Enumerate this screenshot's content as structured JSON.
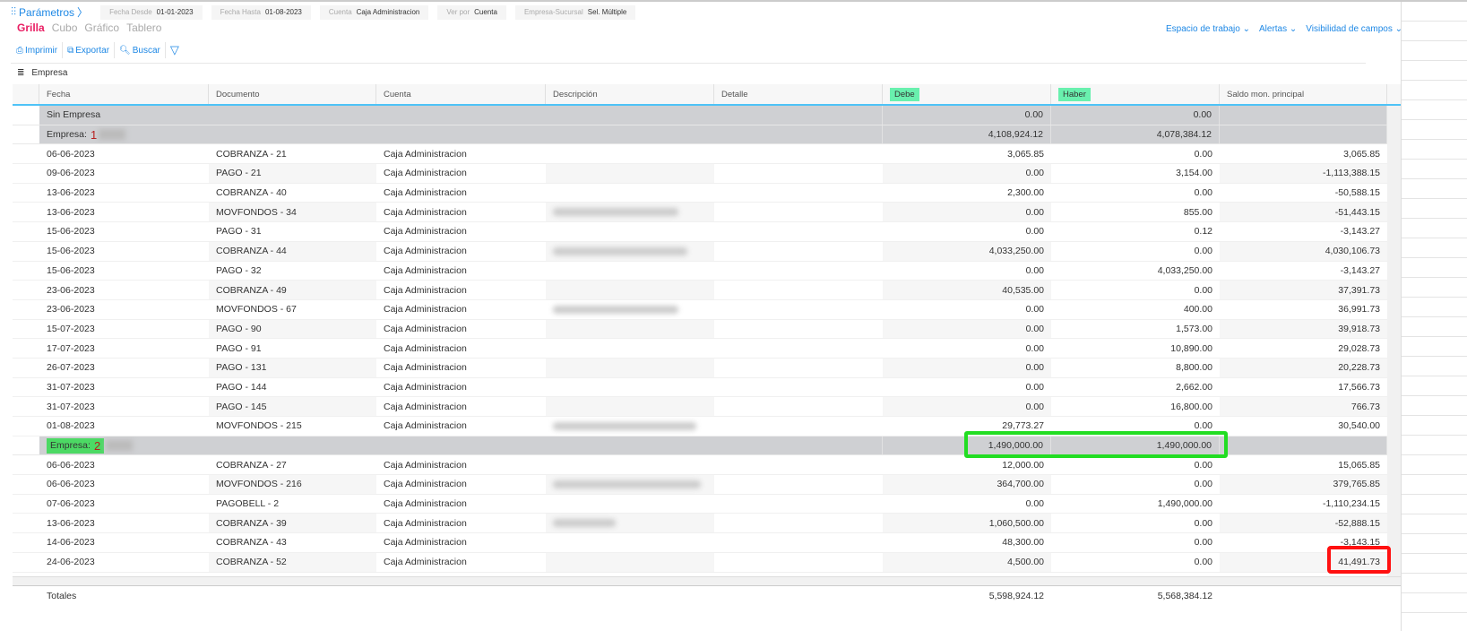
{
  "params": {
    "label": "Parámetros",
    "filters": [
      {
        "label": "Fecha Desde",
        "value": "01-01-2023"
      },
      {
        "label": "Fecha Hasta",
        "value": "01-08-2023"
      },
      {
        "label": "Cuenta",
        "value": "Caja Administracion"
      },
      {
        "label": "Ver por",
        "value": "Cuenta"
      },
      {
        "label": "Empresa-Sucursal",
        "value": "Sel. Múltiple"
      }
    ]
  },
  "views": [
    "Grilla",
    "Cubo",
    "Gráfico",
    "Tablero"
  ],
  "toolbar": {
    "print": "Imprimir",
    "export": "Exportar",
    "search": "Buscar"
  },
  "rightmenu": [
    "Espacio de trabajo",
    "Alertas",
    "Visibilidad de campos"
  ],
  "group_by": "Empresa",
  "columns": [
    "Fecha",
    "Documento",
    "Cuenta",
    "Descripción",
    "Detalle",
    "Debe",
    "Haber",
    "Saldo mon. principal"
  ],
  "rows": [
    {
      "type": "group",
      "label": "Sin Empresa",
      "debe": "0.00",
      "haber": "0.00"
    },
    {
      "type": "group",
      "label": "Empresa:",
      "num": "1",
      "debe": "4,108,924.12",
      "haber": "4,078,384.12"
    },
    {
      "f": "06-06-2023",
      "d": "COBRANZA - 21",
      "c": "Caja Administracion",
      "debe": "3,065.85",
      "haber": "0.00",
      "s": "3,065.85"
    },
    {
      "f": "09-06-2023",
      "d": "PAGO - 21",
      "c": "Caja Administracion",
      "debe": "0.00",
      "haber": "3,154.00",
      "s": "-1,113,388.15"
    },
    {
      "f": "13-06-2023",
      "d": "COBRANZA - 40",
      "c": "Caja Administracion",
      "debe": "2,300.00",
      "haber": "0.00",
      "s": "-50,588.15"
    },
    {
      "f": "13-06-2023",
      "d": "MOVFONDOS - 34",
      "c": "Caja Administracion",
      "debe": "0.00",
      "haber": "855.00",
      "s": "-51,443.15",
      "blur": 140
    },
    {
      "f": "15-06-2023",
      "d": "PAGO - 31",
      "c": "Caja Administracion",
      "debe": "0.00",
      "haber": "0.12",
      "s": "-3,143.27"
    },
    {
      "f": "15-06-2023",
      "d": "COBRANZA - 44",
      "c": "Caja Administracion",
      "debe": "4,033,250.00",
      "haber": "0.00",
      "s": "4,030,106.73",
      "blur": 150
    },
    {
      "f": "15-06-2023",
      "d": "PAGO - 32",
      "c": "Caja Administracion",
      "debe": "0.00",
      "haber": "4,033,250.00",
      "s": "-3,143.27"
    },
    {
      "f": "23-06-2023",
      "d": "COBRANZA - 49",
      "c": "Caja Administracion",
      "debe": "40,535.00",
      "haber": "0.00",
      "s": "37,391.73"
    },
    {
      "f": "23-06-2023",
      "d": "MOVFONDOS - 67",
      "c": "Caja Administracion",
      "debe": "0.00",
      "haber": "400.00",
      "s": "36,991.73",
      "blur": 140
    },
    {
      "f": "15-07-2023",
      "d": "PAGO - 90",
      "c": "Caja Administracion",
      "debe": "0.00",
      "haber": "1,573.00",
      "s": "39,918.73"
    },
    {
      "f": "17-07-2023",
      "d": "PAGO - 91",
      "c": "Caja Administracion",
      "debe": "0.00",
      "haber": "10,890.00",
      "s": "29,028.73"
    },
    {
      "f": "26-07-2023",
      "d": "PAGO - 131",
      "c": "Caja Administracion",
      "debe": "0.00",
      "haber": "8,800.00",
      "s": "20,228.73"
    },
    {
      "f": "31-07-2023",
      "d": "PAGO - 144",
      "c": "Caja Administracion",
      "debe": "0.00",
      "haber": "2,662.00",
      "s": "17,566.73"
    },
    {
      "f": "31-07-2023",
      "d": "PAGO - 145",
      "c": "Caja Administracion",
      "debe": "0.00",
      "haber": "16,800.00",
      "s": "766.73"
    },
    {
      "f": "01-08-2023",
      "d": "MOVFONDOS - 215",
      "c": "Caja Administracion",
      "debe": "29,773.27",
      "haber": "0.00",
      "s": "30,540.00",
      "blur": 160
    },
    {
      "type": "group",
      "label": "Empresa:",
      "num": "2",
      "hl": true,
      "debe": "1,490,000.00",
      "haber": "1,490,000.00"
    },
    {
      "f": "06-06-2023",
      "d": "COBRANZA - 27",
      "c": "Caja Administracion",
      "debe": "12,000.00",
      "haber": "0.00",
      "s": "15,065.85"
    },
    {
      "f": "06-06-2023",
      "d": "MOVFONDOS - 216",
      "c": "Caja Administracion",
      "debe": "364,700.00",
      "haber": "0.00",
      "s": "379,765.85",
      "blur": 165
    },
    {
      "f": "07-06-2023",
      "d": "PAGOBELL - 2",
      "c": "Caja Administracion",
      "debe": "0.00",
      "haber": "1,490,000.00",
      "s": "-1,110,234.15"
    },
    {
      "f": "13-06-2023",
      "d": "COBRANZA - 39",
      "c": "Caja Administracion",
      "debe": "1,060,500.00",
      "haber": "0.00",
      "s": "-52,888.15",
      "blur": 70
    },
    {
      "f": "14-06-2023",
      "d": "COBRANZA - 43",
      "c": "Caja Administracion",
      "debe": "48,300.00",
      "haber": "0.00",
      "s": "-3,143.15"
    },
    {
      "f": "24-06-2023",
      "d": "COBRANZA - 52",
      "c": "Caja Administracion",
      "debe": "4,500.00",
      "haber": "0.00",
      "s": "41,491.73"
    }
  ],
  "totals": {
    "label": "Totales",
    "debe": "5,598,924.12",
    "haber": "5,568,384.12"
  },
  "colors": {
    "accent": "#1e88e5",
    "active_view": "#e91e63",
    "highlight": "#69f0ae",
    "green_box": "#22dd22",
    "red_box": "#ff1010"
  }
}
